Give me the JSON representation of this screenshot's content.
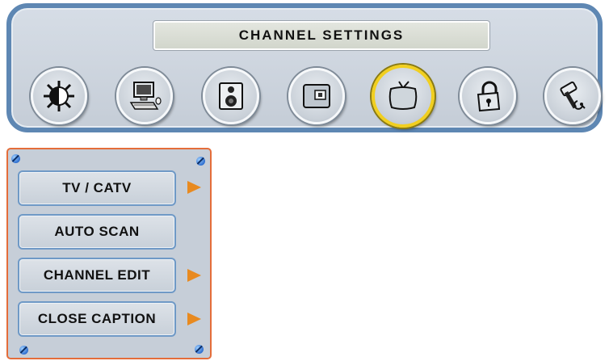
{
  "header": {
    "title": "CHANNEL SETTINGS"
  },
  "icons": [
    {
      "name": "brightness-icon",
      "selected": false
    },
    {
      "name": "computer-icon",
      "selected": false
    },
    {
      "name": "speaker-icon",
      "selected": false
    },
    {
      "name": "picture-in-picture-icon",
      "selected": false
    },
    {
      "name": "tv-icon",
      "selected": true
    },
    {
      "name": "lock-icon",
      "selected": false
    },
    {
      "name": "tools-icon",
      "selected": false
    }
  ],
  "menu": {
    "items": [
      {
        "label": "TV / CATV",
        "has_submenu": true
      },
      {
        "label": "AUTO SCAN",
        "has_submenu": false
      },
      {
        "label": "CHANNEL EDIT",
        "has_submenu": true
      },
      {
        "label": "CLOSE CAPTION",
        "has_submenu": true
      }
    ]
  },
  "colors": {
    "panel_border": "#5e87b3",
    "menu_border": "#e46d3a",
    "selected_ring": "#f1cf1f",
    "arrow": "#e88a20"
  }
}
